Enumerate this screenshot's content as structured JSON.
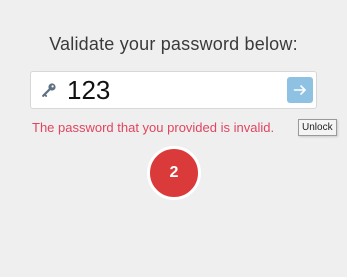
{
  "heading": "Validate your password below:",
  "password_field": {
    "value": "123",
    "icon": "key-icon"
  },
  "submit_button": {
    "icon": "arrow-right-icon",
    "color": "#8fc1e3"
  },
  "error_message": "The password that you provided is invalid.",
  "tooltip": "Unlock",
  "attempt_badge": {
    "count": "2",
    "color": "#db3a3a"
  },
  "colors": {
    "background": "#efefef",
    "error": "#e0455f"
  }
}
